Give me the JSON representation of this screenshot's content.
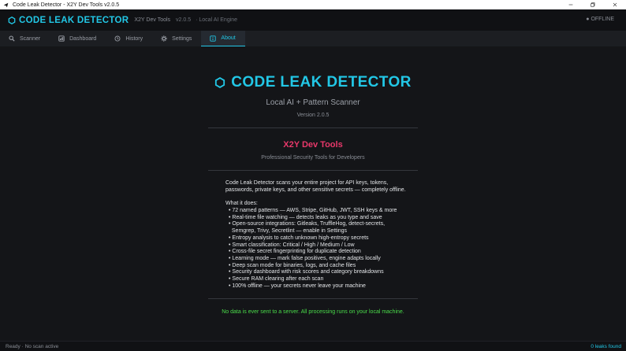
{
  "window": {
    "title": "Code Leak Detector - X2Y Dev Tools  v2.0.5"
  },
  "header": {
    "brand": "CODE LEAK DETECTOR",
    "vendor": "X2Y Dev Tools",
    "version": "v2.0.5",
    "engine": "· Local AI Engine",
    "status": "● OFFLINE"
  },
  "tabs": [
    {
      "label": "Scanner",
      "icon": "search-icon"
    },
    {
      "label": "Dashboard",
      "icon": "dashboard-icon"
    },
    {
      "label": "History",
      "icon": "clock-icon"
    },
    {
      "label": "Settings",
      "icon": "gear-icon"
    },
    {
      "label": "About",
      "icon": "info-icon",
      "active": true
    }
  ],
  "about": {
    "title": "CODE LEAK DETECTOR",
    "subtitle": "Local AI + Pattern Scanner",
    "version": "Version 2.0.5",
    "company": "X2Y Dev Tools",
    "tagline": "Professional Security Tools for Developers",
    "description": "Code Leak Detector scans your entire project for API keys, tokens, passwords, private keys, and other sensitive secrets — completely offline.",
    "features_heading": "What it does:",
    "features": [
      "• 72 named patterns — AWS, Stripe, GitHub, JWT, SSH keys & more",
      "• Real-time file watching — detects leaks as you type and save",
      "• Open-source integrations: Gitleaks, TruffleHog, detect-secrets,",
      "  Semgrep, Trivy, Secretlint — enable in Settings",
      "• Entropy analysis to catch unknown high-entropy secrets",
      "• Smart classification: Critical / High / Medium / Low",
      "• Cross-file secret fingerprinting for duplicate detection",
      "• Learning mode — mark false positives, engine adapts locally",
      "• Deep scan mode for binaries, logs, and cache files",
      "• Security dashboard with risk scores and category breakdowns",
      "• Secure RAM clearing after each scan",
      "• 100% offline — your secrets never leave your machine"
    ],
    "privacy_note": "No data is ever sent to a server. All processing runs on your local machine."
  },
  "statusbar": {
    "left": "Ready  ·  No scan active",
    "right": "0 leaks found"
  },
  "colors": {
    "accent": "#22c7e6",
    "brand_pink": "#e8386a",
    "ok_green": "#4ade4a",
    "background": "#141518"
  }
}
